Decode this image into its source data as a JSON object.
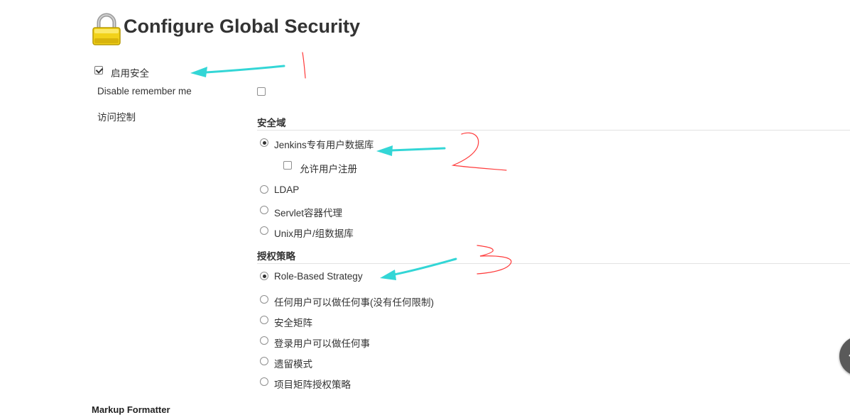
{
  "page": {
    "title": "Configure Global Security",
    "lock_icon": "lock-icon"
  },
  "enable_security": {
    "label": "启用安全",
    "checked": true
  },
  "disable_remember_me": {
    "label": "Disable remember me",
    "checked": false
  },
  "access_control": {
    "label": "访问控制"
  },
  "security_realm": {
    "heading": "安全域",
    "options": [
      {
        "label": "Jenkins专有用户数据库",
        "selected": true
      },
      {
        "label": "LDAP",
        "selected": false
      },
      {
        "label": "Servlet容器代理",
        "selected": false
      },
      {
        "label": "Unix用户/组数据库",
        "selected": false
      }
    ],
    "allow_signup": {
      "label": "允许用户注册",
      "checked": false
    }
  },
  "authorization": {
    "heading": "授权策略",
    "options": [
      {
        "label": "Role-Based Strategy",
        "selected": true
      },
      {
        "label": "任何用户可以做任何事(没有任何限制)",
        "selected": false
      },
      {
        "label": "安全矩阵",
        "selected": false
      },
      {
        "label": "登录用户可以做任何事",
        "selected": false
      },
      {
        "label": "遗留模式",
        "selected": false
      },
      {
        "label": "项目矩阵授权策略",
        "selected": false
      }
    ]
  },
  "next_section": {
    "heading": "Markup Formatter"
  },
  "annotations": {
    "arrow_color": "#33d6d6",
    "mark_color": "#ff3b3b",
    "arrow_icon": "arrow-icon"
  }
}
